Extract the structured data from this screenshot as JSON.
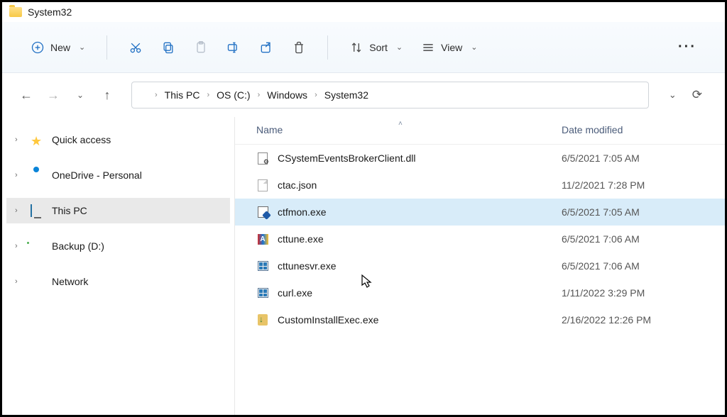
{
  "title": "System32",
  "toolbar": {
    "new_label": "New",
    "sort_label": "Sort",
    "view_label": "View"
  },
  "breadcrumb": [
    "This PC",
    "OS (C:)",
    "Windows",
    "System32"
  ],
  "columns": {
    "name": "Name",
    "date": "Date modified"
  },
  "sidebar": {
    "items": [
      {
        "label": "Quick access",
        "icon": "star"
      },
      {
        "label": "OneDrive - Personal",
        "icon": "cloud"
      },
      {
        "label": "This PC",
        "icon": "pc",
        "selected": true
      },
      {
        "label": "Backup (D:)",
        "icon": "drive"
      },
      {
        "label": "Network",
        "icon": "net"
      }
    ]
  },
  "files": [
    {
      "name": "CSystemEventsBrokerClient.dll",
      "date": "6/5/2021 7:05 AM",
      "icon": "dll"
    },
    {
      "name": "ctac.json",
      "date": "11/2/2021 7:28 PM",
      "icon": "json"
    },
    {
      "name": "ctfmon.exe",
      "date": "6/5/2021 7:05 AM",
      "icon": "exe1",
      "selected": true
    },
    {
      "name": "cttune.exe",
      "date": "6/5/2021 7:06 AM",
      "icon": "ct"
    },
    {
      "name": "cttunesvr.exe",
      "date": "6/5/2021 7:06 AM",
      "icon": "win"
    },
    {
      "name": "curl.exe",
      "date": "1/11/2022 3:29 PM",
      "icon": "win"
    },
    {
      "name": "CustomInstallExec.exe",
      "date": "2/16/2022 12:26 PM",
      "icon": "inst"
    }
  ]
}
